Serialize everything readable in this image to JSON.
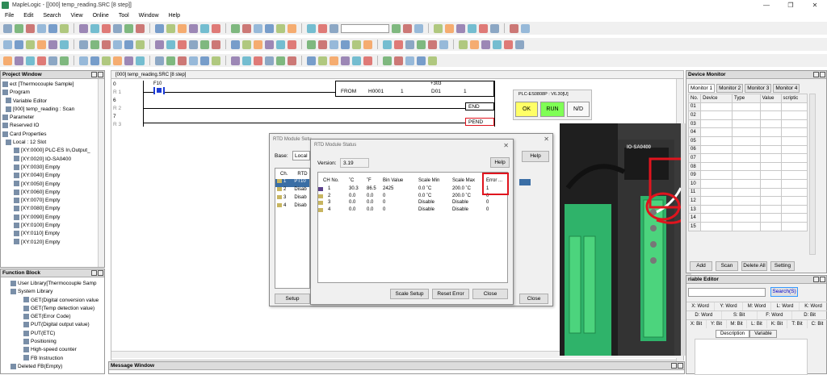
{
  "window": {
    "title": "MapleLogic - [[000] temp_reading.SRC [8 step]]"
  },
  "menu": [
    "File",
    "Edit",
    "Search",
    "View",
    "Online",
    "Tool",
    "Window",
    "Help"
  ],
  "project_window": {
    "title": "Project Window",
    "items": [
      {
        "label": "ect [Thermocouple Sample]",
        "indent": 0
      },
      {
        "label": "Program",
        "indent": 0
      },
      {
        "label": "Variable Editor",
        "indent": 4
      },
      {
        "label": "[000] temp_reading : Scan",
        "indent": 4
      },
      {
        "label": "Parameter",
        "indent": 0
      },
      {
        "label": "Reserved IO",
        "indent": 0
      },
      {
        "label": "Card Properties",
        "indent": 0
      },
      {
        "label": "Local : 12 Slot",
        "indent": 4
      },
      {
        "label": "[XY:0000] PLC-ES In,Output_",
        "indent": 14
      },
      {
        "label": "[XY:0020] IO-SA0400",
        "indent": 14
      },
      {
        "label": "[XY:0030] Empty",
        "indent": 14
      },
      {
        "label": "[XY:0040] Empty",
        "indent": 14
      },
      {
        "label": "[XY:0050] Empty",
        "indent": 14
      },
      {
        "label": "[XY:0060] Empty",
        "indent": 14
      },
      {
        "label": "[XY:0070] Empty",
        "indent": 14
      },
      {
        "label": "[XY:0080] Empty",
        "indent": 14
      },
      {
        "label": "[XY:0090] Empty",
        "indent": 14
      },
      {
        "label": "[XY:0100] Empty",
        "indent": 14
      },
      {
        "label": "[XY:0110] Empty",
        "indent": 14
      },
      {
        "label": "[XY:0120] Empty",
        "indent": 14
      }
    ]
  },
  "function_block": {
    "title": "Function Block",
    "items": [
      {
        "label": "User Library[Thermocouple Samp",
        "indent": 10
      },
      {
        "label": "System Library",
        "indent": 10
      },
      {
        "label": "GET(Digital conversion value",
        "indent": 26
      },
      {
        "label": "GET(Temp detection value)",
        "indent": 26
      },
      {
        "label": "GET(Error Code)",
        "indent": 26
      },
      {
        "label": "PUT(Digital output value)",
        "indent": 26
      },
      {
        "label": "PUT(ETC)",
        "indent": 26
      },
      {
        "label": "Positioning",
        "indent": 26
      },
      {
        "label": "High-speed counter",
        "indent": 26
      },
      {
        "label": "FB Instruction",
        "indent": 26
      },
      {
        "label": "Deleted FB(Empty)",
        "indent": 10
      }
    ]
  },
  "editor": {
    "tab": "[000] temp_reading.SRC [8 step]",
    "rows": [
      {
        "step": "0",
        "rung": "R 1"
      },
      {
        "step": "6",
        "rung": "R 2"
      },
      {
        "step": "7",
        "rung": "R 3"
      }
    ],
    "contact": "F10",
    "from_instr": {
      "op": "FROM",
      "a": "H0001",
      "b": "1",
      "above": "+303",
      "c": "D01",
      "d": "1"
    },
    "end": "END",
    "pend": "PEND"
  },
  "plc_status": {
    "title": "PLC-ES0808P : V6.30[U]",
    "ok": "OK",
    "run": "RUN",
    "nd": "N/D"
  },
  "rtd_setup": {
    "title": "RTD Module Setu",
    "base_label": "Base:",
    "base_value": "Local",
    "col_ch": "Ch.",
    "col_rtd": "RTD",
    "rows": [
      {
        "ch": "1",
        "val": "PT10"
      },
      {
        "ch": "2",
        "val": "Disab"
      },
      {
        "ch": "3",
        "val": "Disab"
      },
      {
        "ch": "4",
        "val": "Disab"
      }
    ],
    "setup_btn": "Setup",
    "help_btn": "Help",
    "close_btn": "Close"
  },
  "rtd_status": {
    "title": "RTD Module Status",
    "version_label": "Version:",
    "version_value": "3.19",
    "help_btn": "Help",
    "columns": [
      "CH No.",
      "˚C",
      "˚F",
      "Bin Value",
      "Scale Min",
      "Scale Max",
      "Error ..."
    ],
    "rows": [
      [
        "1",
        "30.3",
        "86.5",
        "2425",
        "0.0 ˚C",
        "200.0 ˚C",
        "1"
      ],
      [
        "2",
        "0.0",
        "0.0",
        "0",
        "0.0 ˚C",
        "200.0 ˚C",
        "0"
      ],
      [
        "3",
        "0.0",
        "0.0",
        "0",
        "Disable",
        "Disable",
        "0"
      ],
      [
        "4",
        "0.0",
        "0.0",
        "0",
        "Disable",
        "Disable",
        "0"
      ]
    ],
    "scale_setup_btn": "Scale Setup",
    "reset_error_btn": "Reset Error",
    "close_btn": "Close"
  },
  "photo": {
    "module_label": "IO-SA0400"
  },
  "device_monitor": {
    "title": "Device Monitor",
    "tabs": [
      "Monitor 1",
      "Monitor 2",
      "Monitor 3",
      "Monitor 4"
    ],
    "columns": [
      "No.",
      "Device",
      "Type",
      "Value",
      "scriptic"
    ],
    "rows": [
      "01",
      "02",
      "03",
      "04",
      "05",
      "06",
      "07",
      "08",
      "09",
      "10",
      "11",
      "12",
      "13",
      "14",
      "15"
    ],
    "buttons": [
      "Add",
      "Scan",
      "Delete All",
      "Setting"
    ]
  },
  "variable_editor": {
    "title": "riable Editor",
    "search_btn": "Search(S)",
    "grid": [
      [
        "X: Word",
        "Y: Word",
        "M: Word",
        "L: Word",
        "K: Word"
      ],
      [
        "D: Word",
        "S: Bit",
        "F: Word",
        "D: Bit"
      ],
      [
        "X: Bit",
        "Y: Bit",
        "M: Bit",
        "L: Bit",
        "K: Bit",
        "T: Bit",
        "C: Bit"
      ]
    ],
    "tabs": [
      "Description",
      "Variable"
    ]
  },
  "message_window": {
    "title": "Message Window"
  },
  "colors": {
    "accent_red": "#e0141e",
    "ok_yellow": "#ffff66",
    "run_green": "#7fff55",
    "pcb_green": "#2fb36a"
  }
}
